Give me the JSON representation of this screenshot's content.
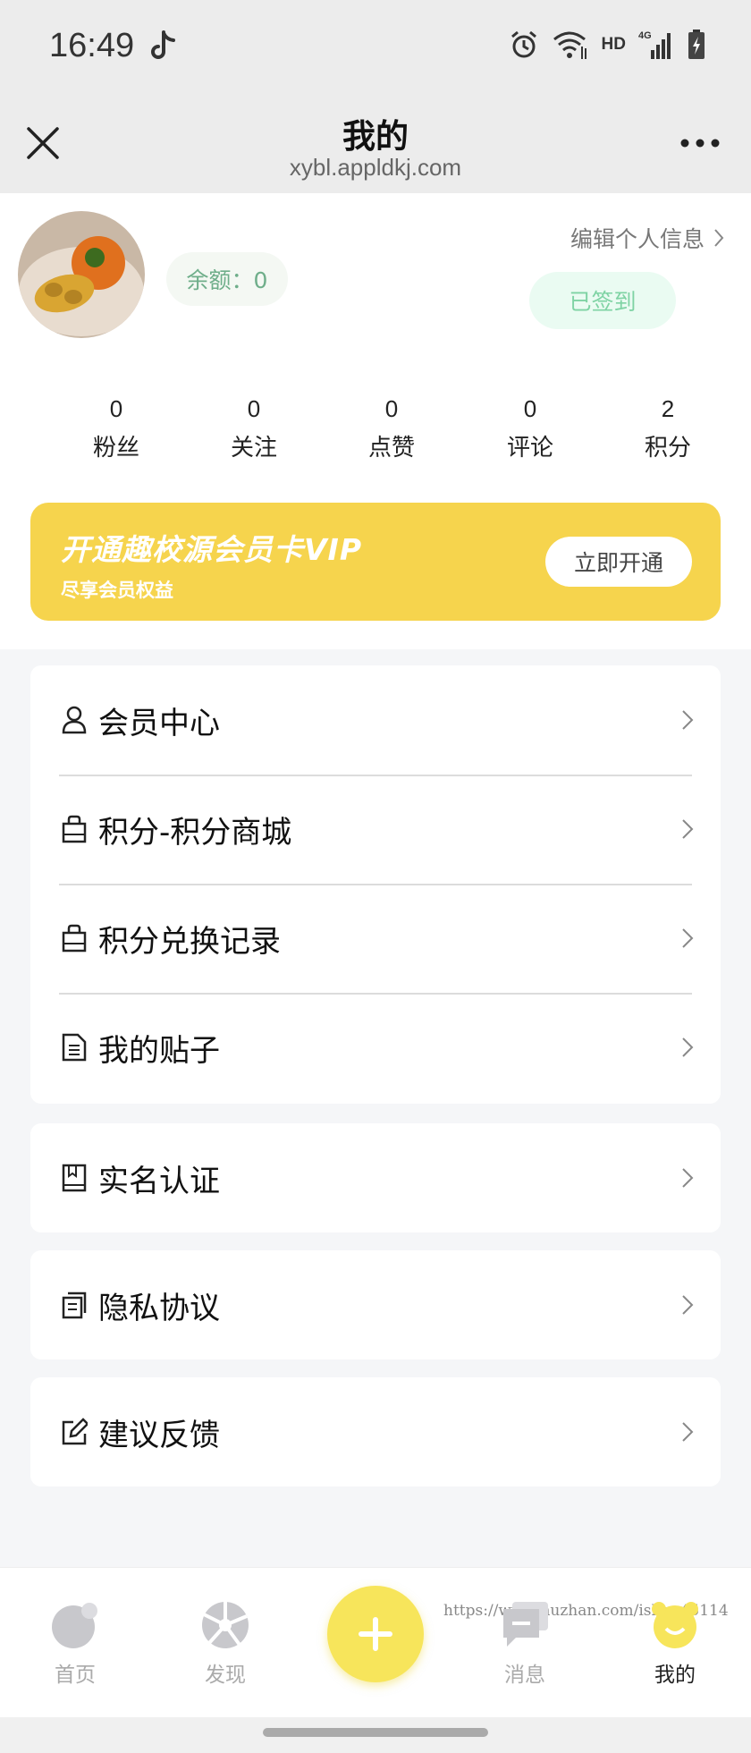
{
  "status_bar": {
    "time": "16:49",
    "network": "4G",
    "hd": "HD"
  },
  "title_bar": {
    "title": "我的",
    "url": "xybl.appldkj.com"
  },
  "profile": {
    "balance": "余额：0",
    "edit_label": "编辑个人信息",
    "signin_label": "已签到"
  },
  "stats": [
    {
      "value": "0",
      "label": "粉丝"
    },
    {
      "value": "0",
      "label": "关注"
    },
    {
      "value": "0",
      "label": "点赞"
    },
    {
      "value": "0",
      "label": "评论"
    },
    {
      "value": "2",
      "label": "积分"
    }
  ],
  "vip": {
    "title": "开通趣校源会员卡VIP",
    "subtitle": "尽享会员权益",
    "button": "立即开通"
  },
  "menu_group_1": [
    {
      "label": "会员中心",
      "icon": "user-icon"
    },
    {
      "label": "积分-积分商城",
      "icon": "bag-icon"
    },
    {
      "label": "积分兑换记录",
      "icon": "bag-icon"
    },
    {
      "label": "我的贴子",
      "icon": "document-icon"
    }
  ],
  "menu_single": [
    {
      "label": "实名认证",
      "icon": "bookmark-book-icon"
    },
    {
      "label": "隐私协议",
      "icon": "copy-document-icon"
    },
    {
      "label": "建议反馈",
      "icon": "edit-icon"
    }
  ],
  "bottom_nav": {
    "items": [
      {
        "label": "首页",
        "icon": "home-icon"
      },
      {
        "label": "发现",
        "icon": "discover-icon"
      },
      {
        "label": "消息",
        "icon": "message-icon"
      },
      {
        "label": "我的",
        "icon": "profile-icon"
      }
    ],
    "fab_icon": "plus-icon",
    "watermark": "https://www.huzhan.com/ishop45114"
  },
  "colors": {
    "accent_yellow": "#f6d44d",
    "fab_yellow": "#f7e55b",
    "signin_green": "#7fd3a4",
    "balance_green": "#6fae8a"
  }
}
